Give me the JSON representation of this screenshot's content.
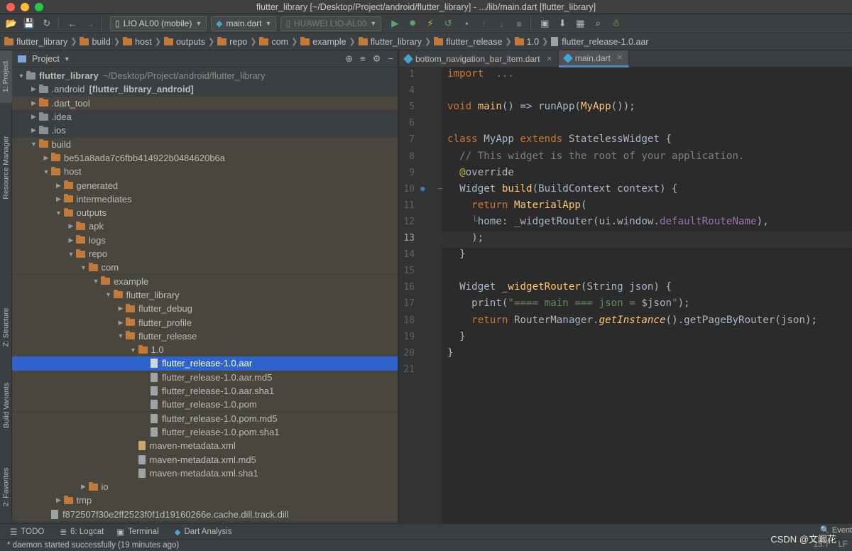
{
  "window": {
    "title": "flutter_library [~/Desktop/Project/android/flutter_library] - .../lib/main.dart [flutter_library]"
  },
  "toolbar": {
    "device_combo": "LIO AL00 (mobile)",
    "config_combo": "main.dart",
    "target_combo": "HUAWEI LIO-AL00"
  },
  "breadcrumbs": [
    "flutter_library",
    "build",
    "host",
    "outputs",
    "repo",
    "com",
    "example",
    "flutter_library",
    "flutter_release",
    "1.0",
    "flutter_release-1.0.aar"
  ],
  "project_panel": {
    "title": "Project"
  },
  "tree": [
    {
      "label": "flutter_library",
      "extra": "~/Desktop/Project/android/flutter_library",
      "depth": 0,
      "arrow": "down",
      "icon": "folder-gray",
      "bold": true
    },
    {
      "label": ".android",
      "extra": "[flutter_library_android]",
      "depth": 1,
      "arrow": "right",
      "icon": "folder-gray",
      "bold_extra": true
    },
    {
      "label": ".dart_tool",
      "depth": 1,
      "arrow": "right",
      "icon": "folder",
      "excluded": true
    },
    {
      "label": ".idea",
      "depth": 1,
      "arrow": "right",
      "icon": "folder-gray"
    },
    {
      "label": ".ios",
      "depth": 1,
      "arrow": "right",
      "icon": "folder-gray"
    },
    {
      "label": "build",
      "depth": 1,
      "arrow": "down",
      "icon": "folder",
      "excluded": true
    },
    {
      "label": "be51a8ada7c6fbb414922b0484620b6a",
      "depth": 2,
      "arrow": "right",
      "icon": "folder",
      "excluded": true
    },
    {
      "label": "host",
      "depth": 2,
      "arrow": "down",
      "icon": "folder",
      "excluded": true
    },
    {
      "label": "generated",
      "depth": 3,
      "arrow": "right",
      "icon": "folder",
      "excluded": true
    },
    {
      "label": "intermediates",
      "depth": 3,
      "arrow": "right",
      "icon": "folder",
      "excluded": true
    },
    {
      "label": "outputs",
      "depth": 3,
      "arrow": "down",
      "icon": "folder",
      "excluded": true
    },
    {
      "label": "apk",
      "depth": 4,
      "arrow": "right",
      "icon": "folder",
      "excluded": true
    },
    {
      "label": "logs",
      "depth": 4,
      "arrow": "right",
      "icon": "folder",
      "excluded": true
    },
    {
      "label": "repo",
      "depth": 4,
      "arrow": "down",
      "icon": "folder",
      "excluded": true
    },
    {
      "label": "com",
      "depth": 5,
      "arrow": "down",
      "icon": "folder",
      "excluded": true
    },
    {
      "label": "example",
      "depth": 6,
      "arrow": "down",
      "icon": "folder",
      "excluded": true
    },
    {
      "label": "flutter_library",
      "depth": 7,
      "arrow": "down",
      "icon": "folder",
      "excluded": true
    },
    {
      "label": "flutter_debug",
      "depth": 8,
      "arrow": "right",
      "icon": "folder",
      "excluded": true
    },
    {
      "label": "flutter_profile",
      "depth": 8,
      "arrow": "right",
      "icon": "folder",
      "excluded": true
    },
    {
      "label": "flutter_release",
      "depth": 8,
      "arrow": "down",
      "icon": "folder",
      "excluded": true
    },
    {
      "label": "1.0",
      "depth": 9,
      "arrow": "down",
      "icon": "folder",
      "excluded": true
    },
    {
      "label": "flutter_release-1.0.aar",
      "depth": 10,
      "arrow": "none",
      "icon": "file",
      "selected": true
    },
    {
      "label": "flutter_release-1.0.aar.md5",
      "depth": 10,
      "arrow": "none",
      "icon": "file",
      "excluded": true
    },
    {
      "label": "flutter_release-1.0.aar.sha1",
      "depth": 10,
      "arrow": "none",
      "icon": "file",
      "excluded": true
    },
    {
      "label": "flutter_release-1.0.pom",
      "depth": 10,
      "arrow": "none",
      "icon": "file",
      "excluded": true
    },
    {
      "label": "flutter_release-1.0.pom.md5",
      "depth": 10,
      "arrow": "none",
      "icon": "file",
      "excluded": true
    },
    {
      "label": "flutter_release-1.0.pom.sha1",
      "depth": 10,
      "arrow": "none",
      "icon": "file",
      "excluded": true
    },
    {
      "label": "maven-metadata.xml",
      "depth": 9,
      "arrow": "none",
      "icon": "file-xml",
      "excluded": true
    },
    {
      "label": "maven-metadata.xml.md5",
      "depth": 9,
      "arrow": "none",
      "icon": "file",
      "excluded": true
    },
    {
      "label": "maven-metadata.xml.sha1",
      "depth": 9,
      "arrow": "none",
      "icon": "file",
      "excluded": true
    },
    {
      "label": "io",
      "depth": 5,
      "arrow": "right",
      "icon": "folder",
      "excluded": true
    },
    {
      "label": "tmp",
      "depth": 3,
      "arrow": "right",
      "icon": "folder",
      "excluded": true
    },
    {
      "label": "f872507f30e2ff2523f0f1d19160266e.cache.dill.track.dill",
      "depth": 2,
      "arrow": "none",
      "icon": "file",
      "excluded": true
    }
  ],
  "editor_tabs": [
    {
      "label": "bottom_navigation_bar_item.dart",
      "active": false
    },
    {
      "label": "main.dart",
      "active": true
    }
  ],
  "code": [
    {
      "n": "1",
      "tokens": [
        [
          "kw",
          "import"
        ],
        [
          "",
          "  "
        ],
        [
          "cm",
          "..."
        ]
      ]
    },
    {
      "n": "4",
      "tokens": []
    },
    {
      "n": "5",
      "tokens": [
        [
          "kw",
          "void "
        ],
        [
          "fn",
          "main"
        ],
        [
          "",
          "() => runApp("
        ],
        [
          "fn",
          "MyApp"
        ],
        [
          "",
          "());"
        ]
      ]
    },
    {
      "n": "6",
      "tokens": []
    },
    {
      "n": "7",
      "tokens": [
        [
          "kw",
          "class "
        ],
        [
          "",
          "MyApp "
        ],
        [
          "kw",
          "extends "
        ],
        [
          "",
          "StatelessWidget {"
        ]
      ]
    },
    {
      "n": "8",
      "tokens": [
        [
          "cm",
          "  // This widget is the root of your application."
        ]
      ]
    },
    {
      "n": "9",
      "tokens": [
        [
          "an",
          "  @"
        ],
        [
          "",
          "override"
        ]
      ]
    },
    {
      "n": "10",
      "tokens": [
        [
          "",
          "  Widget "
        ],
        [
          "fn",
          "build"
        ],
        [
          "",
          "(BuildContext context) {"
        ]
      ]
    },
    {
      "n": "11",
      "tokens": [
        [
          "kw",
          "    return "
        ],
        [
          "fn",
          "MaterialApp"
        ],
        [
          "",
          "("
        ]
      ]
    },
    {
      "n": "12",
      "tokens": [
        [
          "fold-ic",
          "    └"
        ],
        [
          "",
          "home: _widgetRouter(ui.window."
        ],
        [
          "pr",
          "defaultRouteName"
        ],
        [
          "",
          "),"
        ]
      ]
    },
    {
      "n": "13",
      "tokens": [
        [
          "",
          "    );"
        ]
      ]
    },
    {
      "n": "14",
      "tokens": [
        [
          "",
          "  }"
        ]
      ]
    },
    {
      "n": "15",
      "tokens": []
    },
    {
      "n": "16",
      "tokens": [
        [
          "",
          "  Widget "
        ],
        [
          "fn",
          "_widgetRouter"
        ],
        [
          "",
          "(String json) {"
        ]
      ]
    },
    {
      "n": "17",
      "tokens": [
        [
          "",
          "    print("
        ],
        [
          "st",
          "\"==== main === json = "
        ],
        [
          "",
          "$json"
        ],
        [
          "st",
          "\""
        ],
        [
          "",
          ");"
        ]
      ]
    },
    {
      "n": "18",
      "tokens": [
        [
          "kw",
          "    return "
        ],
        [
          "",
          "RouterManager."
        ],
        [
          "it",
          "getInstance"
        ],
        [
          "",
          "().getPageByRouter(json);"
        ]
      ]
    },
    {
      "n": "19",
      "tokens": [
        [
          "",
          "  }"
        ]
      ]
    },
    {
      "n": "20",
      "tokens": [
        [
          "",
          "}"
        ]
      ]
    },
    {
      "n": "21",
      "tokens": []
    }
  ],
  "current_line": "13",
  "left_tool_tabs": [
    "1: Project",
    "Resource Manager",
    "Z: Structure",
    "Build Variants",
    "2: Favorites"
  ],
  "bottom_tools": [
    "TODO",
    "6: Logcat",
    "Terminal",
    "Dart Analysis"
  ],
  "status": {
    "message": "* daemon started successfully (19 minutes ago)",
    "position": "13:7",
    "line_sep": "LF",
    "event_log": "Event"
  },
  "watermark": "CSDN @文阚花",
  "colors": {
    "selection": "#2f65ca",
    "editor_bg": "#2b2b2b",
    "panel_bg": "#3c3f41",
    "keyword": "#cc7832",
    "function": "#ffc66d"
  }
}
